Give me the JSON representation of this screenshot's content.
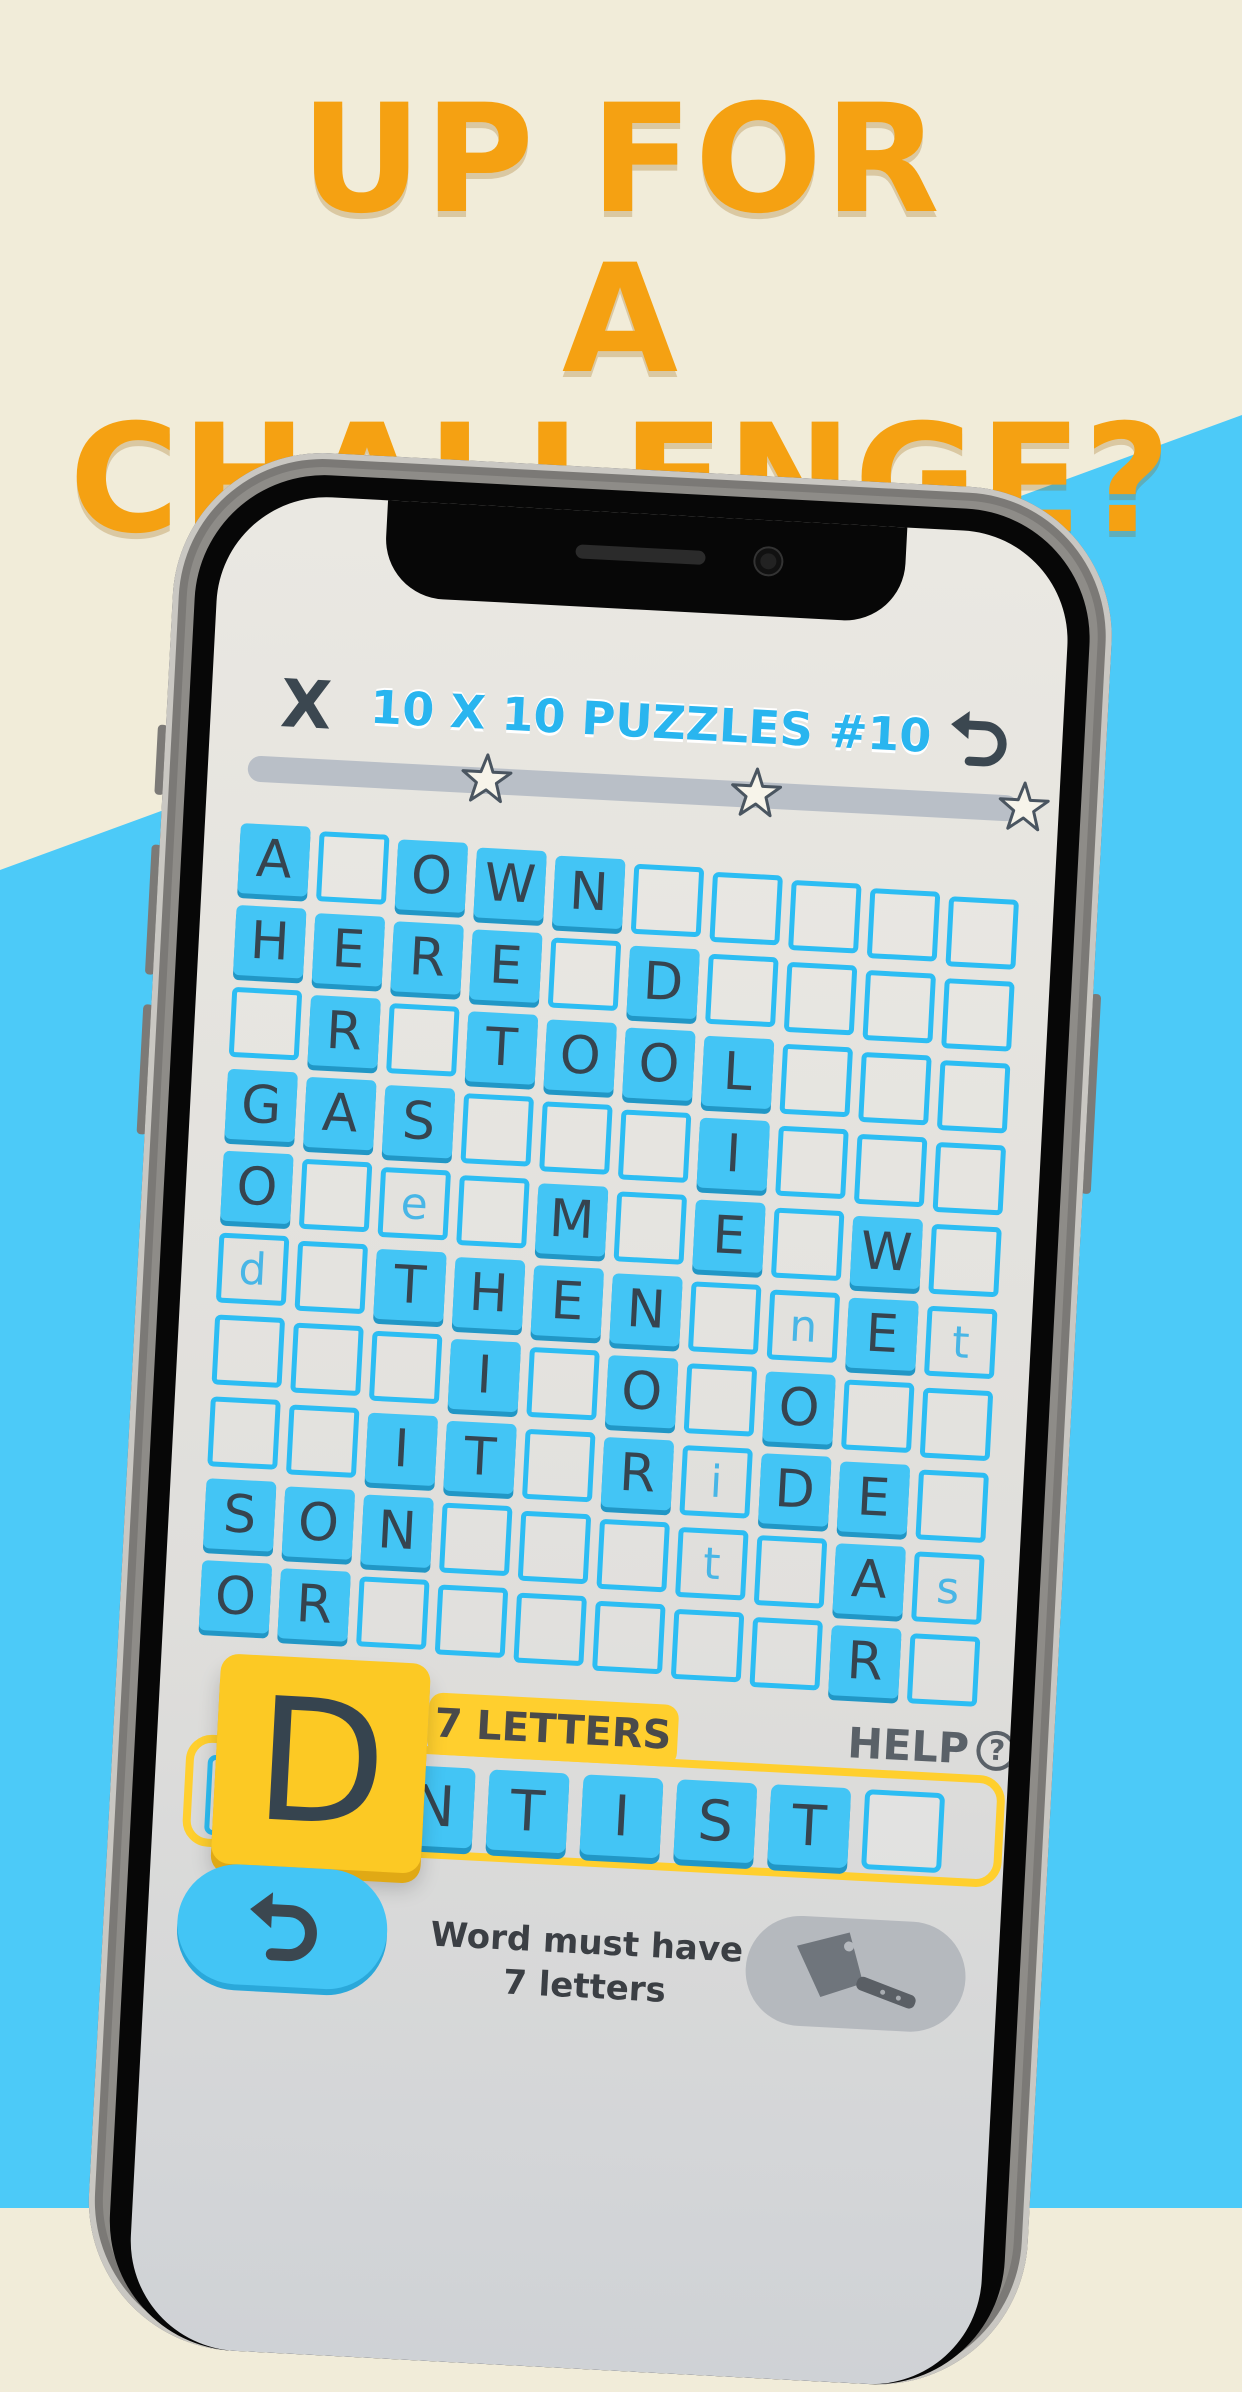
{
  "headline": {
    "line1": "UP FOR",
    "line2": "A CHALLENGE?"
  },
  "colors": {
    "accent": "#f5a112",
    "grid_blue": "#2cbdf3",
    "tile_blue": "#43c5f5",
    "yellow": "#ffcf2e"
  },
  "header": {
    "close_label": "X",
    "title": "10 X 10 PUZZLES #10",
    "undo_icon": "undo-icon"
  },
  "progress": {
    "stars": 3,
    "icon": "star-icon"
  },
  "grid": {
    "rows": [
      [
        "A",
        "",
        "O",
        "W",
        "N",
        "",
        "",
        "",
        "",
        ""
      ],
      [
        "H",
        "E",
        "R",
        "E",
        "",
        "D",
        "",
        "",
        "",
        ""
      ],
      [
        "",
        "R",
        "",
        "T",
        "O",
        "O",
        "L",
        "",
        "",
        ""
      ],
      [
        "G",
        "A",
        "S",
        "",
        "",
        "",
        "I",
        "",
        "",
        ""
      ],
      [
        "O",
        "",
        "e",
        "",
        "M",
        "",
        "E",
        "",
        "W",
        ""
      ],
      [
        "d",
        "",
        "T",
        "H",
        "E",
        "N",
        "",
        "n",
        "E",
        "t"
      ],
      [
        "",
        "",
        "",
        "I",
        "",
        "O",
        "",
        "O",
        "",
        ""
      ],
      [
        "",
        "",
        "I",
        "T",
        "",
        "R",
        "i",
        "D",
        "E",
        ""
      ],
      [
        "S",
        "O",
        "N",
        "",
        "",
        "",
        "t",
        "",
        "A",
        "s"
      ],
      [
        "O",
        "R",
        "",
        "",
        "",
        "",
        "",
        "",
        "R",
        ""
      ]
    ],
    "filled": [
      [
        1,
        0,
        1,
        1,
        1,
        0,
        0,
        0,
        0,
        0
      ],
      [
        1,
        1,
        1,
        1,
        0,
        1,
        0,
        0,
        0,
        0
      ],
      [
        0,
        1,
        0,
        1,
        1,
        1,
        1,
        0,
        0,
        0
      ],
      [
        1,
        1,
        1,
        0,
        0,
        0,
        1,
        0,
        0,
        0
      ],
      [
        1,
        0,
        0,
        0,
        1,
        0,
        1,
        0,
        1,
        0
      ],
      [
        0,
        0,
        1,
        1,
        1,
        1,
        0,
        0,
        1,
        0
      ],
      [
        0,
        0,
        0,
        1,
        0,
        1,
        0,
        1,
        0,
        0
      ],
      [
        0,
        0,
        1,
        1,
        0,
        1,
        0,
        1,
        1,
        0
      ],
      [
        1,
        1,
        1,
        0,
        0,
        0,
        0,
        0,
        1,
        0
      ],
      [
        1,
        1,
        0,
        0,
        0,
        0,
        0,
        0,
        1,
        0
      ]
    ]
  },
  "word_entry": {
    "letters_badge": "7 LETTERS",
    "help_label": "HELP",
    "help_icon": "?",
    "slots": [
      "",
      "",
      "N",
      "T",
      "I",
      "S",
      "T",
      ""
    ],
    "drag_letter": "D"
  },
  "footer": {
    "message": "Word must have 7 letters",
    "back_icon": "undo-arrow-icon",
    "tool_icon": "cleaver-icon"
  }
}
